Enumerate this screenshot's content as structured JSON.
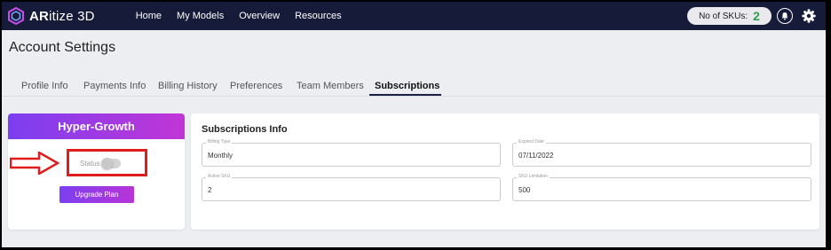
{
  "app": {
    "brand_bold": "AR",
    "brand_rest": "itize 3D"
  },
  "nav": {
    "items": [
      "Home",
      "My Models",
      "Overview",
      "Resources"
    ]
  },
  "header": {
    "sku_label": "No of SKUs:",
    "sku_count": "2"
  },
  "page": {
    "title": "Account Settings"
  },
  "tabs": [
    "Profile Info",
    "Payments Info",
    "Billing History",
    "Preferences",
    "Team Members",
    "Subscriptions"
  ],
  "active_tab": "Subscriptions",
  "plan": {
    "name": "Hyper-Growth",
    "status_label": "Status",
    "status_on": false,
    "upgrade_label": "Upgrade Plan"
  },
  "subscriptions": {
    "title": "Subscriptions Info",
    "fields": [
      {
        "label": "Billing Type",
        "value": "Monthly"
      },
      {
        "label": "Expired Date",
        "value": "07/11/2022"
      },
      {
        "label": "Active SKU",
        "value": "2"
      },
      {
        "label": "SKU Limitation",
        "value": "500"
      }
    ]
  },
  "colors": {
    "nav_bg": "#171b3a",
    "accent_start": "#7b3ff0",
    "accent_end": "#c135d6",
    "annotation_red": "#e11c1c",
    "sku_green": "#2e9e48"
  },
  "icons": [
    "logo-icon",
    "bell-icon",
    "gear-icon",
    "arrow-annotation-icon"
  ]
}
